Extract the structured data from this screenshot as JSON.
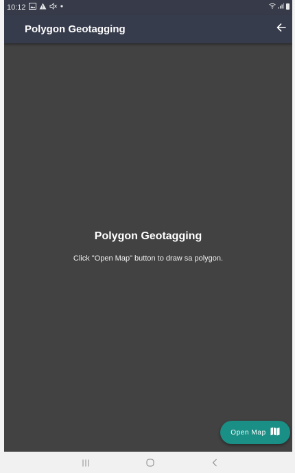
{
  "status_bar": {
    "time": "10:12",
    "icons_left": [
      "photo-icon",
      "warning-icon",
      "mute-icon",
      "dot-icon"
    ],
    "icons_right": [
      "wifi-icon",
      "signal-icon",
      "battery-icon"
    ]
  },
  "app_bar": {
    "title": "Polygon Geotagging",
    "back_icon": "arrow-left-icon"
  },
  "content": {
    "title": "Polygon Geotagging",
    "message": "Click \"Open Map\" button to draw sa polygon."
  },
  "fab": {
    "label": "Open Map",
    "icon": "map-icon",
    "color": "#1a8f86"
  },
  "nav_bar": {
    "items": [
      "recent-apps-icon",
      "home-icon",
      "back-icon"
    ]
  },
  "colors": {
    "app_bar": "#373c4d",
    "background": "#424242"
  }
}
